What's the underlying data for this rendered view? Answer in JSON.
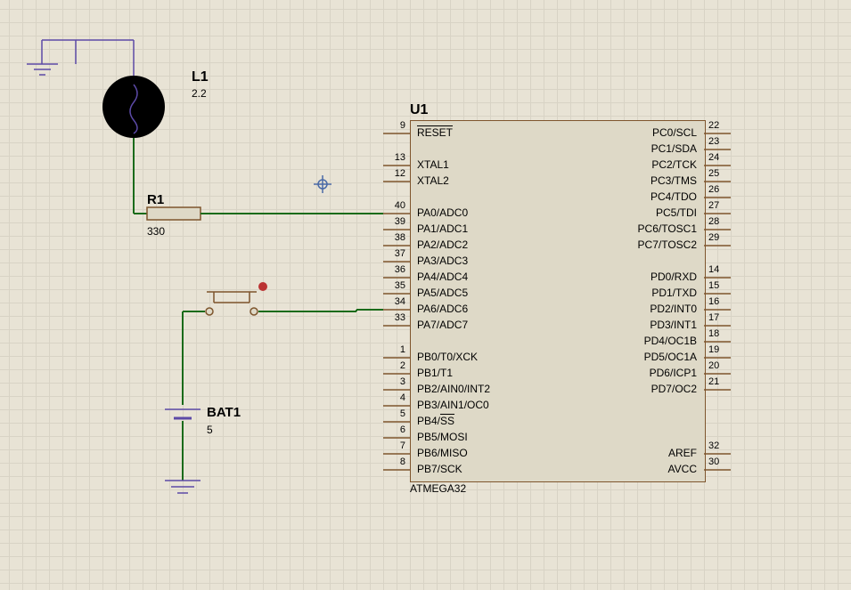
{
  "components": {
    "inductor": {
      "ref": "L1",
      "value": "2.2"
    },
    "resistor": {
      "ref": "R1",
      "value": "330"
    },
    "battery": {
      "ref": "BAT1",
      "value": "5"
    },
    "mcu": {
      "ref": "U1",
      "part": "ATMEGA32"
    }
  },
  "mcu_pins": {
    "left": [
      {
        "num": "9",
        "name": "RESET",
        "over": true
      },
      null,
      {
        "num": "13",
        "name": "XTAL1"
      },
      {
        "num": "12",
        "name": "XTAL2"
      },
      null,
      {
        "num": "40",
        "name": "PA0/ADC0"
      },
      {
        "num": "39",
        "name": "PA1/ADC1"
      },
      {
        "num": "38",
        "name": "PA2/ADC2"
      },
      {
        "num": "37",
        "name": "PA3/ADC3"
      },
      {
        "num": "36",
        "name": "PA4/ADC4"
      },
      {
        "num": "35",
        "name": "PA5/ADC5"
      },
      {
        "num": "34",
        "name": "PA6/ADC6"
      },
      {
        "num": "33",
        "name": "PA7/ADC7"
      },
      null,
      {
        "num": "1",
        "name": "PB0/T0/XCK"
      },
      {
        "num": "2",
        "name": "PB1/T1"
      },
      {
        "num": "3",
        "name": "PB2/AIN0/INT2"
      },
      {
        "num": "4",
        "name": "PB3/AIN1/OC0"
      },
      {
        "num": "5",
        "name": "PB4/SS",
        "over": true,
        "overtext": "SS"
      },
      {
        "num": "6",
        "name": "PB5/MOSI"
      },
      {
        "num": "7",
        "name": "PB6/MISO"
      },
      {
        "num": "8",
        "name": "PB7/SCK"
      }
    ],
    "right": [
      {
        "num": "22",
        "name": "PC0/SCL"
      },
      {
        "num": "23",
        "name": "PC1/SDA"
      },
      {
        "num": "24",
        "name": "PC2/TCK"
      },
      {
        "num": "25",
        "name": "PC3/TMS"
      },
      {
        "num": "26",
        "name": "PC4/TDO"
      },
      {
        "num": "27",
        "name": "PC5/TDI"
      },
      {
        "num": "28",
        "name": "PC6/TOSC1"
      },
      {
        "num": "29",
        "name": "PC7/TOSC2"
      },
      null,
      {
        "num": "14",
        "name": "PD0/RXD"
      },
      {
        "num": "15",
        "name": "PD1/TXD"
      },
      {
        "num": "16",
        "name": "PD2/INT0"
      },
      {
        "num": "17",
        "name": "PD3/INT1"
      },
      {
        "num": "18",
        "name": "PD4/OC1B"
      },
      {
        "num": "19",
        "name": "PD5/OC1A"
      },
      {
        "num": "20",
        "name": "PD6/ICP1"
      },
      {
        "num": "21",
        "name": "PD7/OC2"
      },
      null,
      null,
      null,
      {
        "num": "32",
        "name": "AREF"
      },
      {
        "num": "30",
        "name": "AVCC"
      }
    ]
  },
  "chart_data": {
    "type": "schematic",
    "nets": [
      {
        "name": "GND-top",
        "nodes": [
          "L1.top",
          "GND"
        ]
      },
      {
        "name": "L1-R1",
        "nodes": [
          "L1.bot",
          "R1.left"
        ]
      },
      {
        "name": "R1-PA0",
        "nodes": [
          "R1.right",
          "U1.PA0"
        ]
      },
      {
        "name": "BAT-SW",
        "nodes": [
          "BAT1.pos",
          "SW.left"
        ]
      },
      {
        "name": "SW-PA7",
        "nodes": [
          "SW.right",
          "U1.PA7"
        ]
      },
      {
        "name": "BAT-GND",
        "nodes": [
          "BAT1.neg",
          "GND"
        ]
      }
    ]
  }
}
